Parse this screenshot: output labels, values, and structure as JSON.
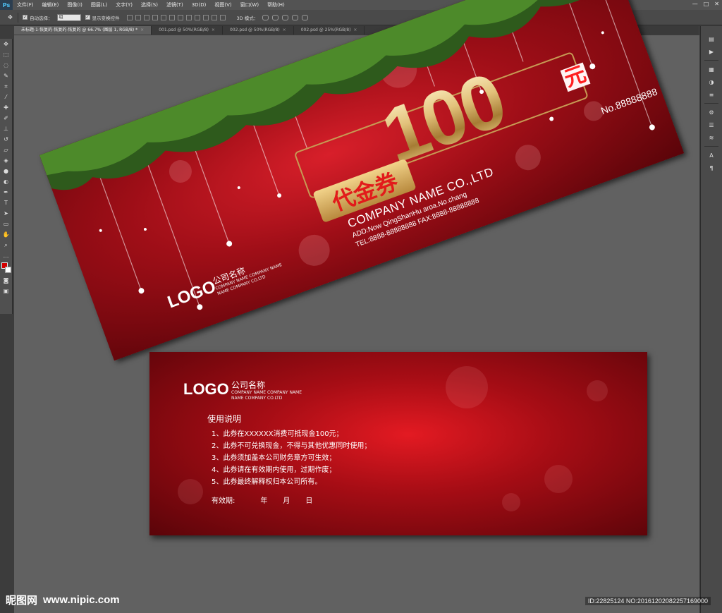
{
  "menubar": {
    "app_logo": "Ps",
    "items": [
      "文件(F)",
      "编辑(E)",
      "图像(I)",
      "图层(L)",
      "文字(Y)",
      "选择(S)",
      "滤镜(T)",
      "3D(D)",
      "视图(V)",
      "窗口(W)",
      "帮助(H)"
    ],
    "win_controls": [
      "—",
      "□",
      "✕"
    ]
  },
  "options": {
    "auto_select_label": "自动选择：",
    "auto_select_value": "组",
    "show_transform_label": "显示变换控件",
    "mode3d_label": "3D 模式："
  },
  "tabs": [
    {
      "label": "未标题-1-恢复的-恢复的-恢复的 @ 66.7% (图层 1, RGB/8) *",
      "active": true
    },
    {
      "label": "001.psd @ 50%(RGB/8)",
      "active": false
    },
    {
      "label": "002.psd @ 50%(RGB/8)",
      "active": false
    },
    {
      "label": "002.psd @ 25%(RGB/8)",
      "active": false
    }
  ],
  "colors": {
    "foreground": "#d40000",
    "background": "#ffffff"
  },
  "front": {
    "logo": "LOGO",
    "company_cn": "公司名称",
    "company_sub1": "COMPANY NAME COMPANY NAME",
    "company_sub2": "NAME COMPANY CO.LTD",
    "voucher_label": "代金券",
    "amount": "100",
    "currency": "元",
    "serial": "No.88888888",
    "company_en": "COMPANY NAME CO.,LTD",
    "address": "ADD:Now QingShanHu aroa.No.chang",
    "tel": "TEL:8888-88888888  FAX:8888-88888888"
  },
  "back": {
    "logo": "LOGO",
    "company_cn": "公司名称",
    "company_sub1": "COMPANY NAME COMPANY NAME",
    "company_sub2": "NAME COMPANY CO.LTD",
    "heading": "使用说明",
    "rules": [
      "1、此券在XXXXXX消费可抵现金100元；",
      "2、此券不可兑换现金，不得与其他优惠同时使用；",
      "3、此券须加盖本公司财务章方可生效；",
      "4、此券请在有效期内使用，过期作废；",
      "5、此券最终解释权归本公司所有。"
    ],
    "validity_label": "有效期:",
    "validity_year": "年",
    "validity_month": "月",
    "validity_day": "日"
  },
  "watermark": {
    "brand": "昵图网",
    "url": "www.nipic.com",
    "id_text": "ID:22825124 NO:20161202082257169000"
  }
}
